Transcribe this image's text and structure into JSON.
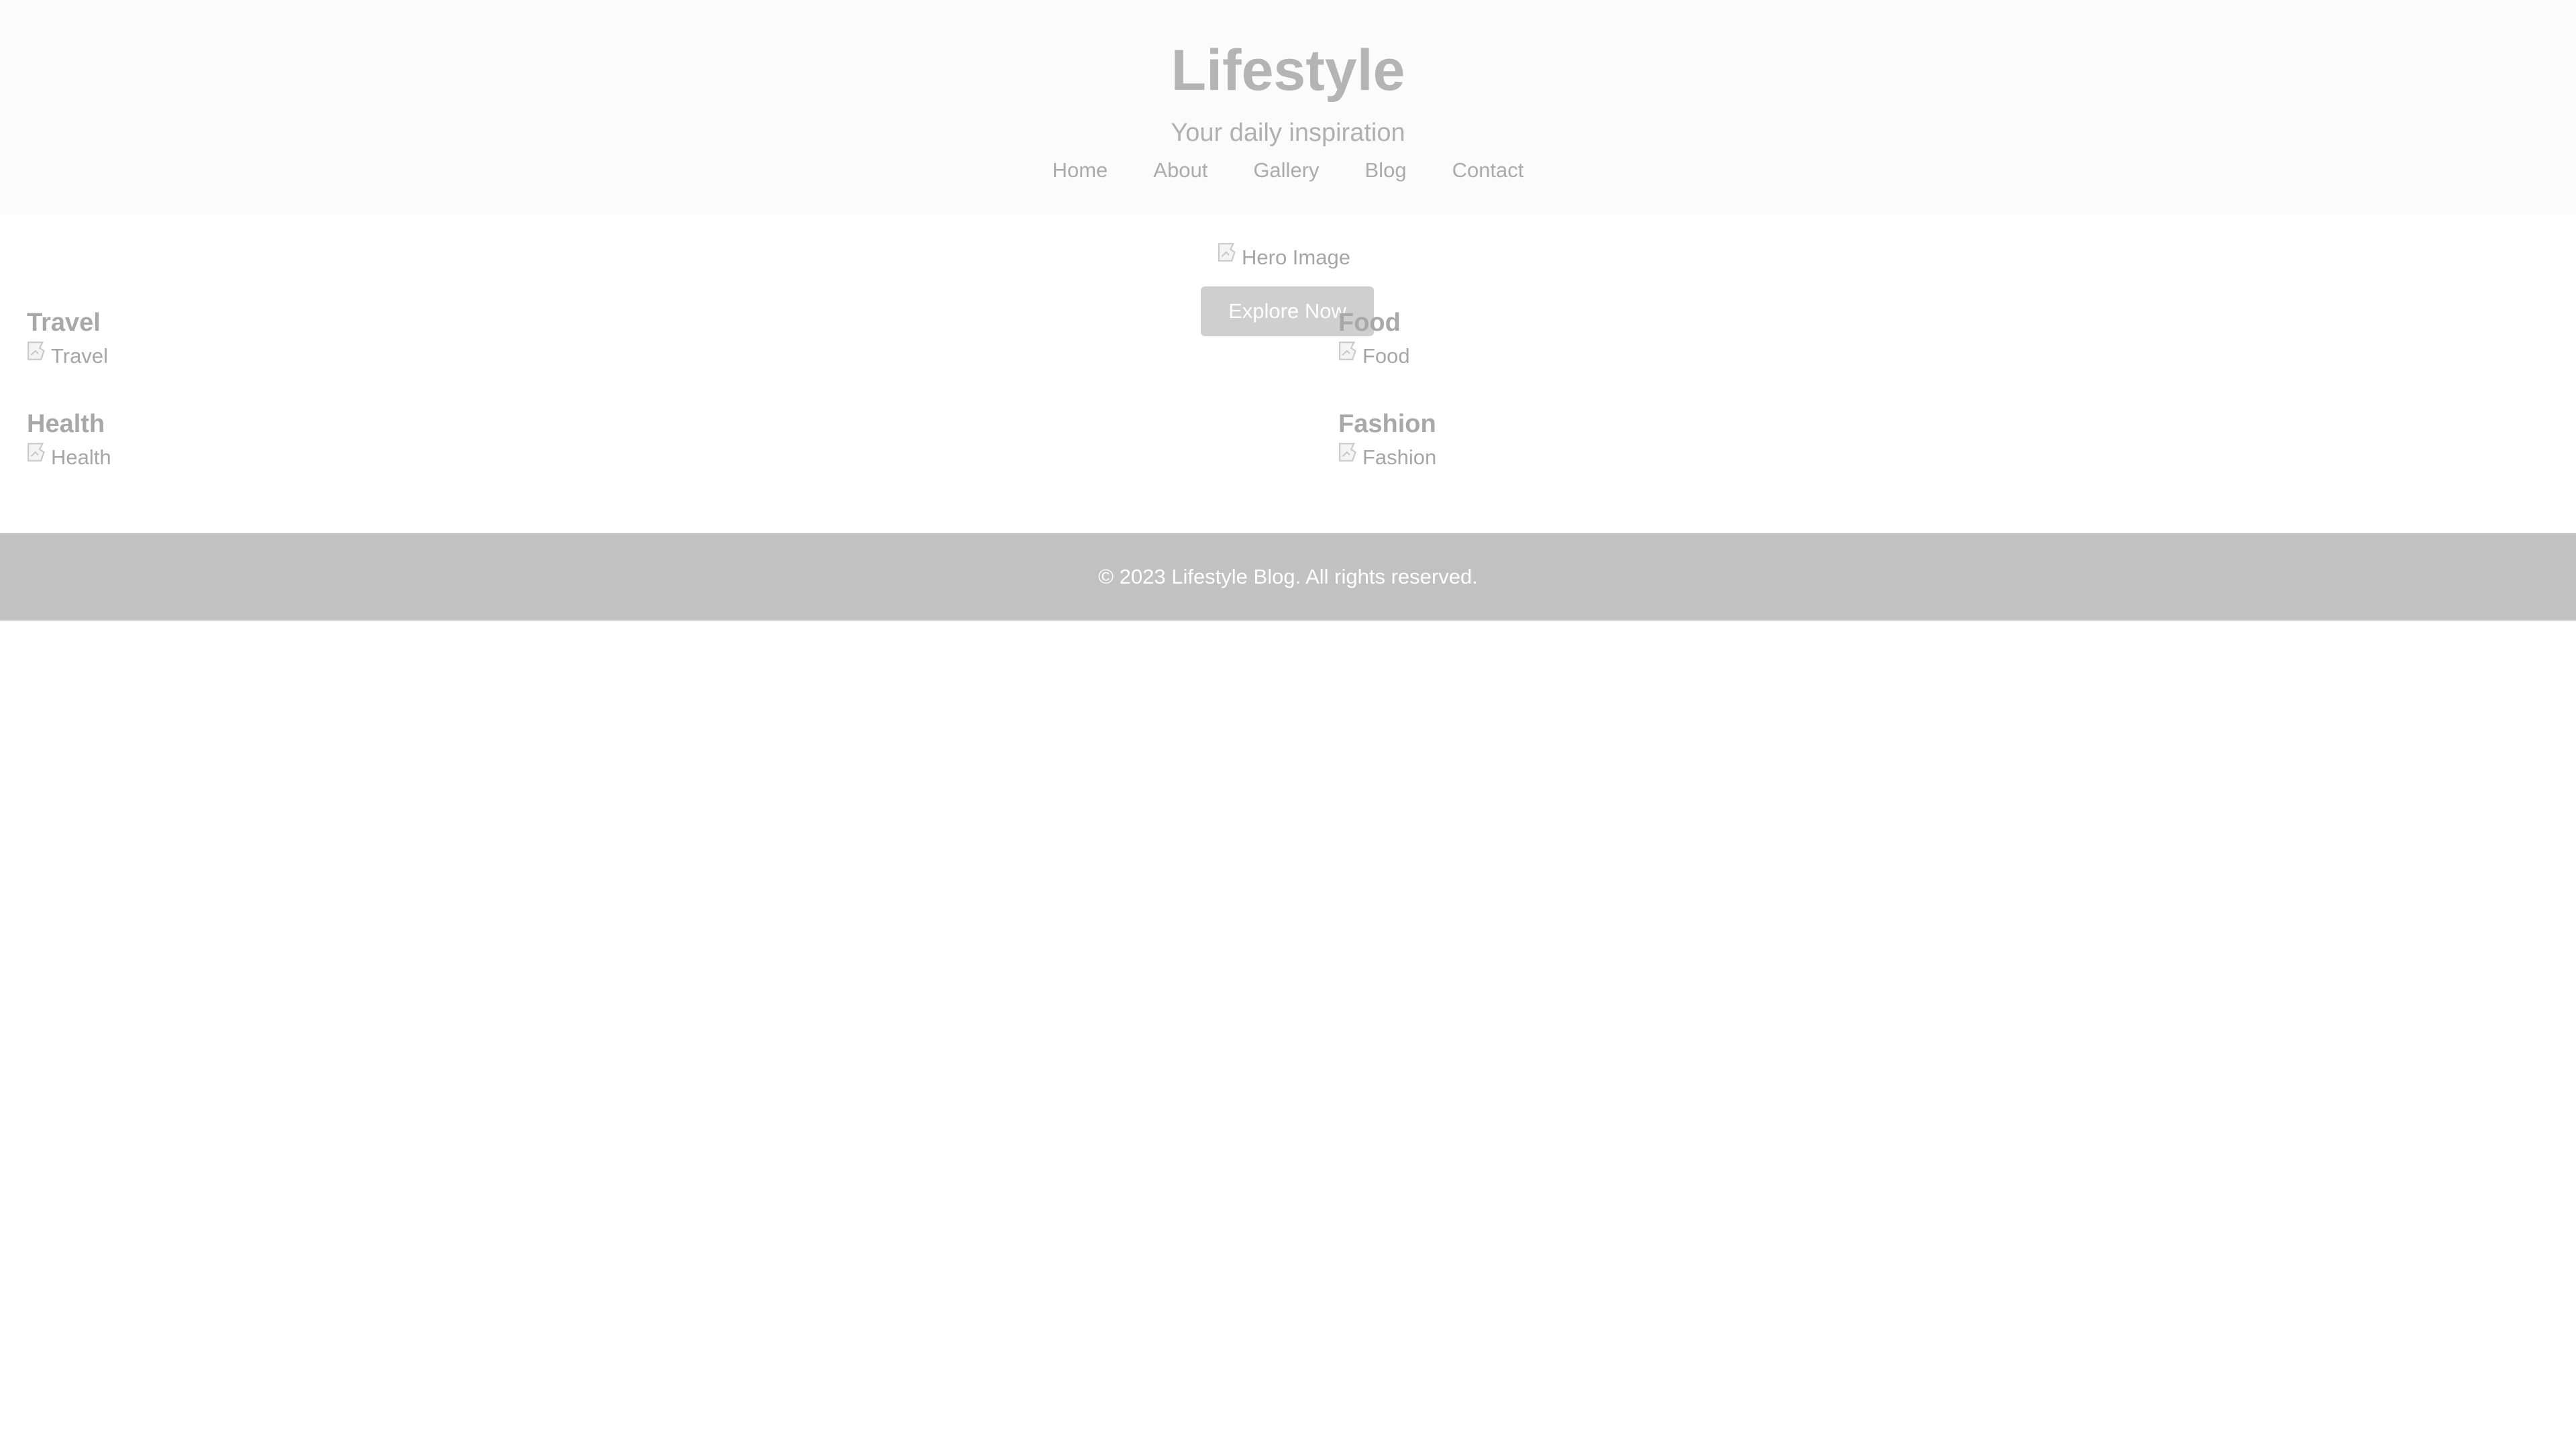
{
  "header": {
    "title": "Lifestyle",
    "tagline": "Your daily inspiration",
    "nav": [
      "Home",
      "About",
      "Gallery",
      "Blog",
      "Contact"
    ]
  },
  "hero": {
    "image_alt": "Hero Image",
    "button_label": "Explore Now"
  },
  "categories": [
    {
      "title": "Travel",
      "image_alt": "Travel"
    },
    {
      "title": "Food",
      "image_alt": "Food"
    },
    {
      "title": "Health",
      "image_alt": "Health"
    },
    {
      "title": "Fashion",
      "image_alt": "Fashion"
    }
  ],
  "footer": {
    "text": "© 2023 Lifestyle Blog. All rights reserved."
  },
  "colors": {
    "header_bg": "#fbfbfb",
    "button_bg": "#cfcfcf",
    "footer_bg": "#c1c1c1"
  },
  "icons": {
    "broken_image": "broken-image-icon"
  }
}
